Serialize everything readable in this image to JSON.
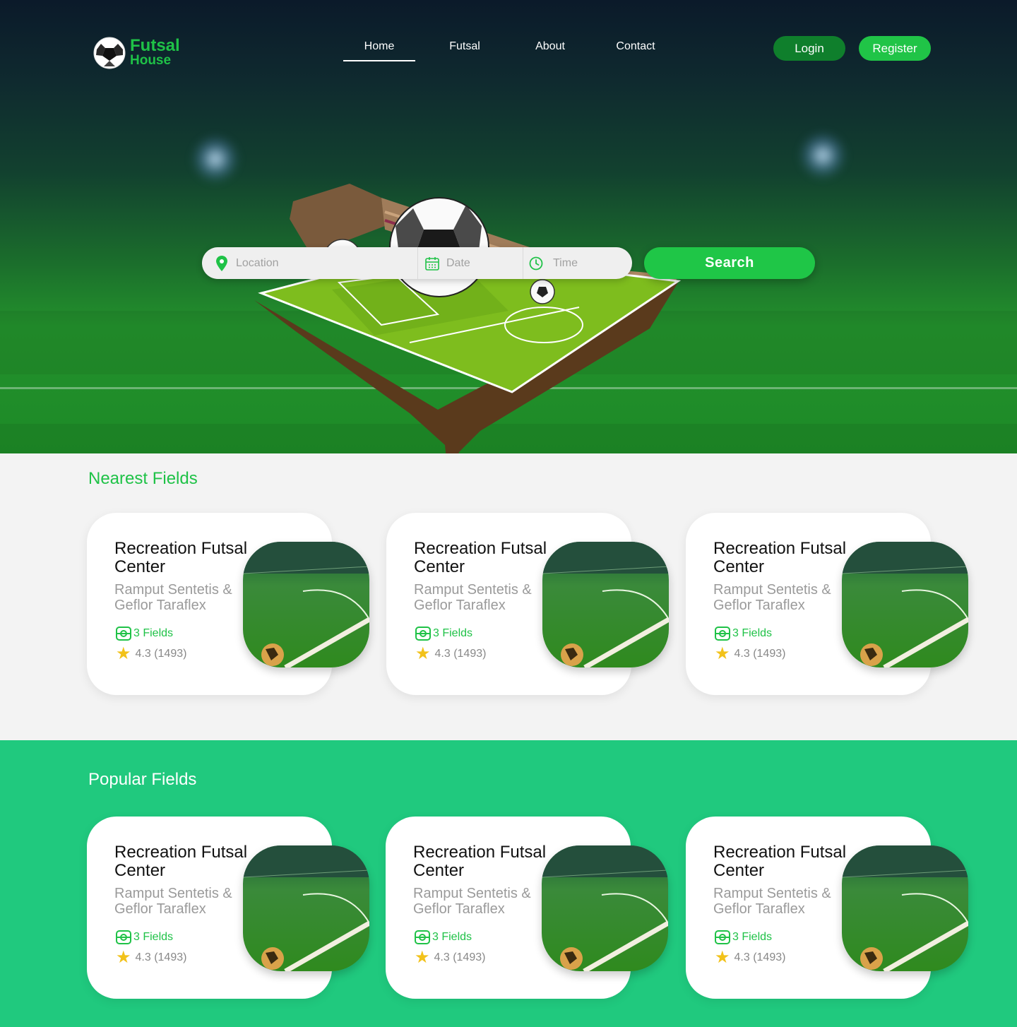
{
  "brand": {
    "line1": "Futsal",
    "line2": "House"
  },
  "nav": [
    {
      "label": "Home",
      "active": true
    },
    {
      "label": "Futsal",
      "active": false
    },
    {
      "label": "About",
      "active": false
    },
    {
      "label": "Contact",
      "active": false
    }
  ],
  "auth": {
    "login": "Login",
    "register": "Register"
  },
  "search": {
    "location_placeholder": "Location",
    "date_placeholder": "Date",
    "time_placeholder": "Time",
    "button": "Search"
  },
  "colors": {
    "accent": "#1fc247",
    "popular_bg": "#20c97e",
    "login_bg": "#0f7f2c",
    "star": "#f2c21a"
  },
  "nearest": {
    "title": "Nearest Fields",
    "cards": [
      {
        "title": "Recreation Futsal Center",
        "subtitle": "Ramput Sentetis & Geflor Taraflex",
        "fields": "3 Fields",
        "rating": "4.3 (1493)"
      },
      {
        "title": "Recreation Futsal Center",
        "subtitle": "Ramput Sentetis & Geflor Taraflex",
        "fields": "3 Fields",
        "rating": "4.3 (1493)"
      },
      {
        "title": "Recreation Futsal Center",
        "subtitle": "Ramput Sentetis & Geflor Taraflex",
        "fields": "3 Fields",
        "rating": "4.3 (1493)"
      }
    ]
  },
  "popular": {
    "title": "Popular Fields",
    "cards": [
      {
        "title": "Recreation Futsal Center",
        "subtitle": "Ramput Sentetis & Geflor Taraflex",
        "fields": "3 Fields",
        "rating": "4.3 (1493)"
      },
      {
        "title": "Recreation Futsal Center",
        "subtitle": "Ramput Sentetis & Geflor Taraflex",
        "fields": "3 Fields",
        "rating": "4.3 (1493)"
      },
      {
        "title": "Recreation Futsal Center",
        "subtitle": "Ramput Sentetis & Geflor Taraflex",
        "fields": "3 Fields",
        "rating": "4.3 (1493)"
      }
    ]
  }
}
